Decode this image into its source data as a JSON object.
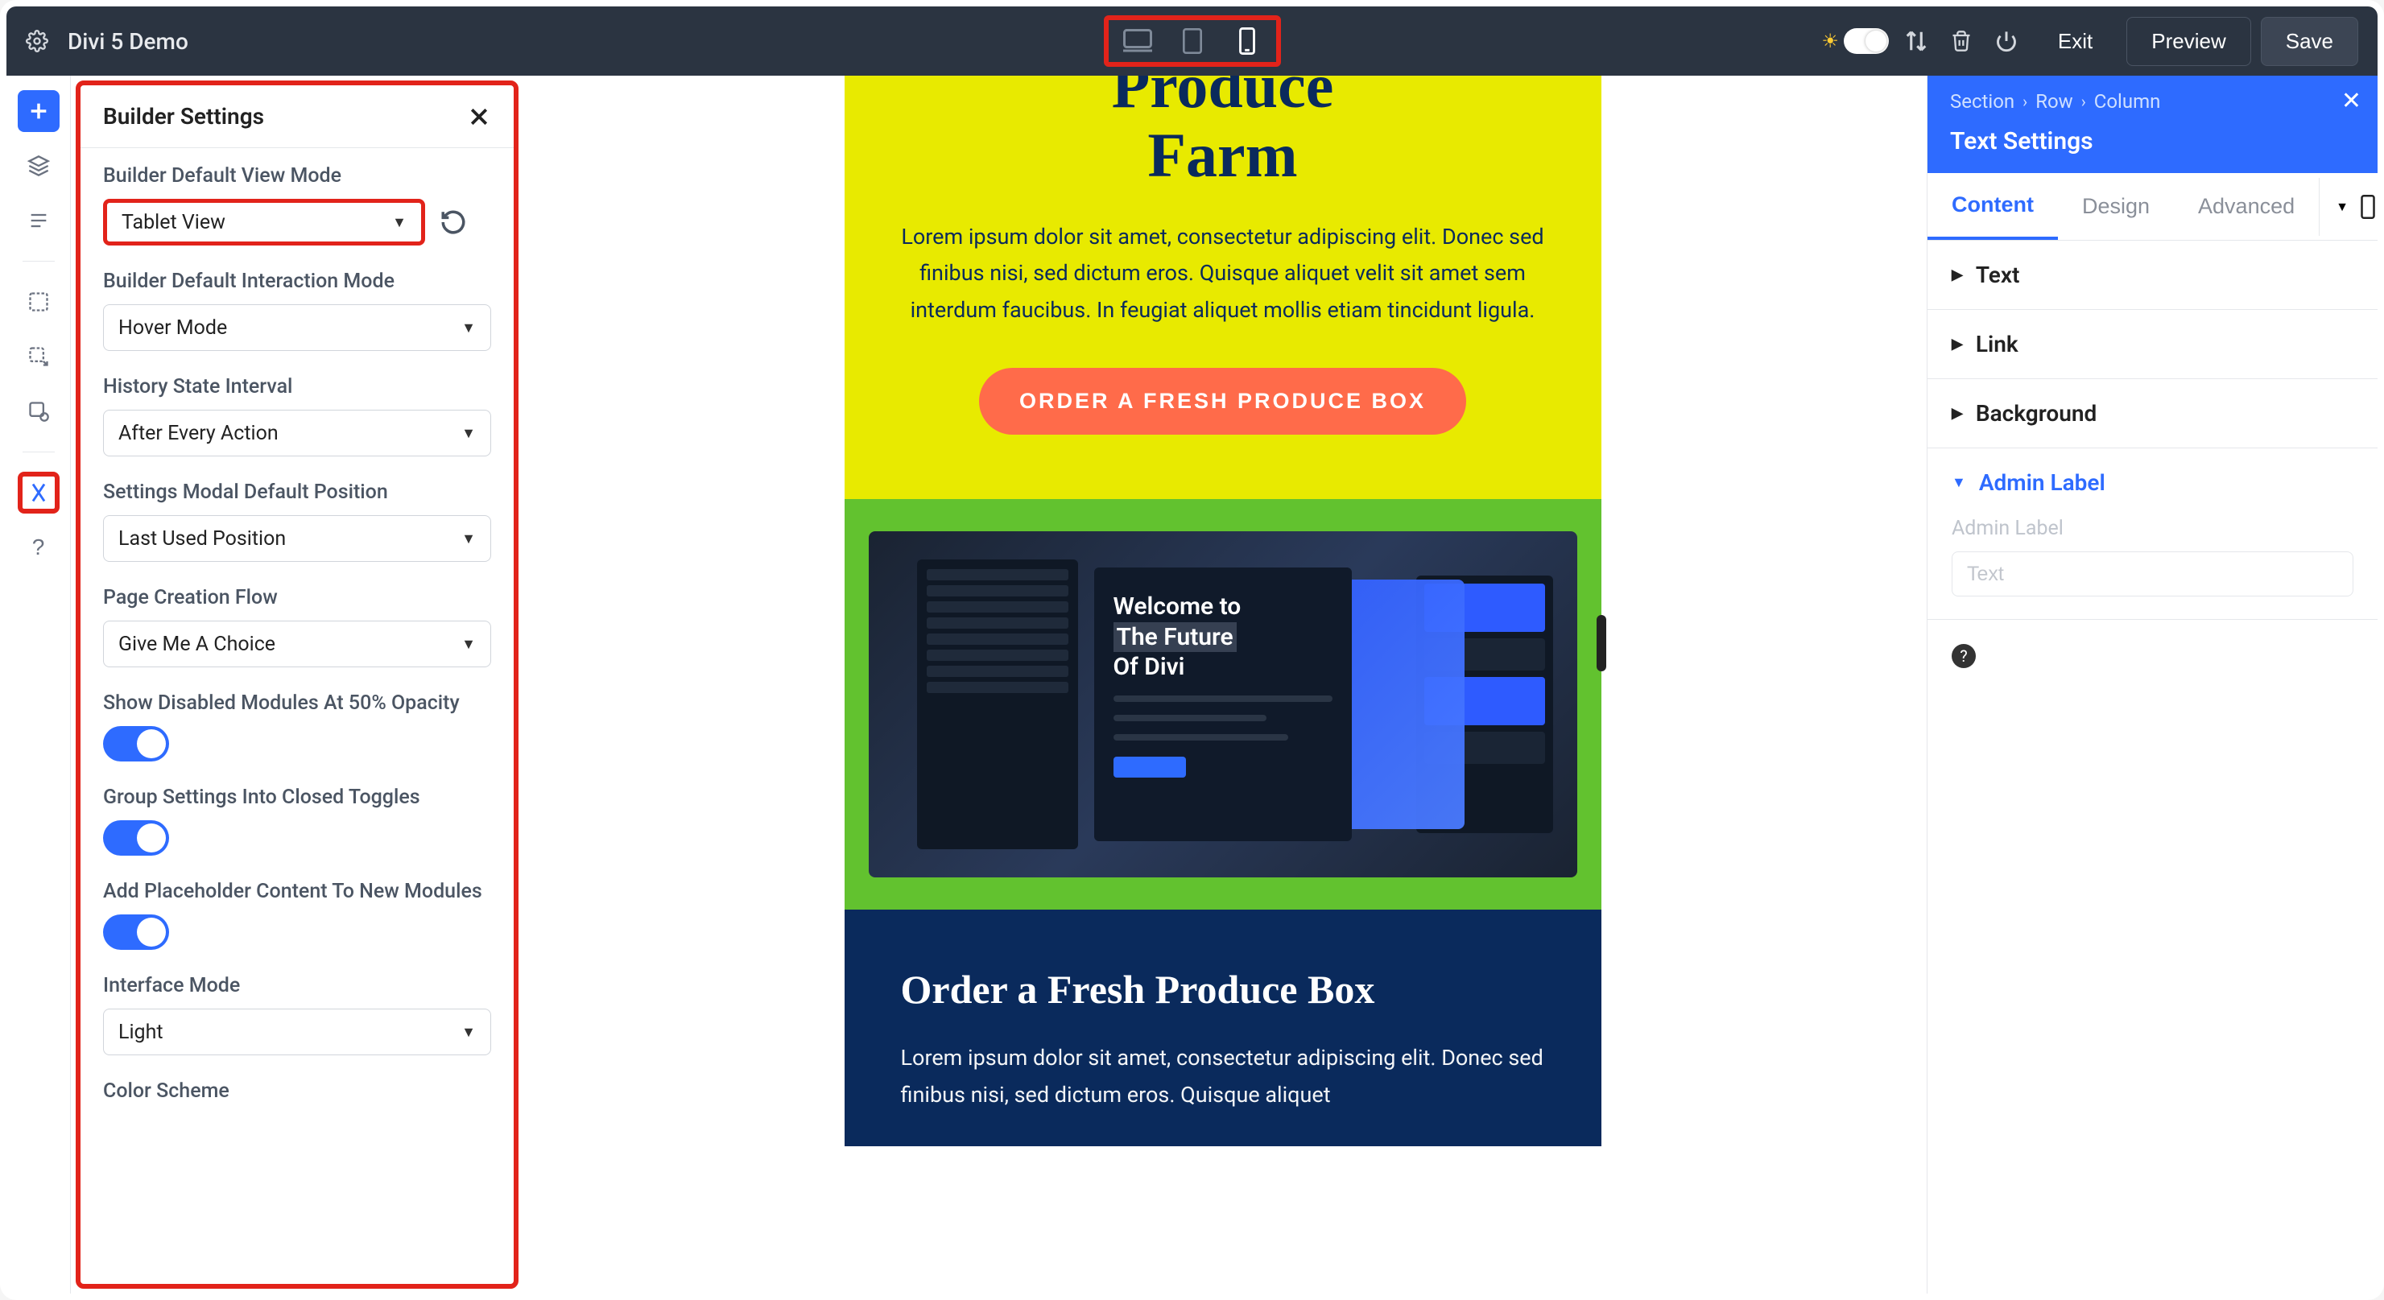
{
  "topbar": {
    "title": "Divi 5 Demo",
    "exit": "Exit",
    "preview": "Preview",
    "save": "Save"
  },
  "panel": {
    "title": "Builder Settings",
    "fields": {
      "view_mode": {
        "label": "Builder Default View Mode",
        "value": "Tablet View"
      },
      "interaction": {
        "label": "Builder Default Interaction Mode",
        "value": "Hover Mode"
      },
      "history": {
        "label": "History State Interval",
        "value": "After Every Action"
      },
      "modal_pos": {
        "label": "Settings Modal Default Position",
        "value": "Last Used Position"
      },
      "creation": {
        "label": "Page Creation Flow",
        "value": "Give Me A Choice"
      },
      "opacity": {
        "label": "Show Disabled Modules At 50% Opacity"
      },
      "group_toggles": {
        "label": "Group Settings Into Closed Toggles"
      },
      "placeholder": {
        "label": "Add Placeholder Content To New Modules"
      },
      "interface": {
        "label": "Interface Mode",
        "value": "Light"
      },
      "color_scheme": {
        "label": "Color Scheme"
      }
    }
  },
  "canvas": {
    "hero_title_1": "Produce",
    "hero_title_2": "Farm",
    "hero_text": "Lorem ipsum dolor sit amet, consectetur adipiscing elit. Donec sed finibus nisi, sed dictum eros. Quisque aliquet velit sit amet sem interdum faucibus. In feugiat aliquet mollis etiam tincidunt ligula.",
    "hero_btn": "ORDER A FRESH PRODUCE BOX",
    "welcome_1": "Welcome to",
    "welcome_2": "The Future",
    "welcome_3": "Of Divi",
    "dark_title": "Order a Fresh Produce Box",
    "dark_text": "Lorem ipsum dolor sit amet, consectetur adipiscing elit. Donec sed finibus nisi, sed dictum eros. Quisque aliquet"
  },
  "rightpanel": {
    "crumb1": "Section",
    "crumb2": "Row",
    "crumb3": "Column",
    "title": "Text Settings",
    "tabs": {
      "content": "Content",
      "design": "Design",
      "advanced": "Advanced"
    },
    "acc": {
      "text": "Text",
      "link": "Link",
      "background": "Background",
      "admin": "Admin Label"
    },
    "admin_label": "Admin Label",
    "admin_placeholder": "Text"
  }
}
